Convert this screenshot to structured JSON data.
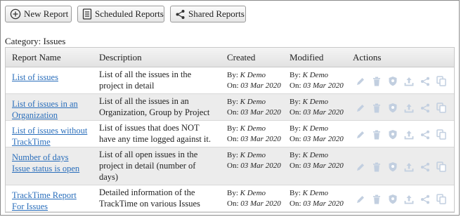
{
  "toolbar": {
    "new_report": "New Report",
    "scheduled_reports": "Scheduled Reports",
    "shared_reports": "Shared Reports"
  },
  "category_label": "Category: Issues",
  "table": {
    "headers": {
      "name": "Report Name",
      "description": "Description",
      "created": "Created",
      "modified": "Modified",
      "actions": "Actions"
    },
    "meta_labels": {
      "by": "By:",
      "on": "On:"
    },
    "rows": [
      {
        "name_lines": [
          "List of issues"
        ],
        "desc_lines": [
          "List of all the issues in the",
          "project in detail"
        ],
        "created_by": "K Demo",
        "created_on": "03 Mar 2020",
        "modified_by": "K Demo",
        "modified_on": "03 Mar 2020"
      },
      {
        "name_lines": [
          "List of issues in an",
          "Organization"
        ],
        "desc_lines": [
          "List of all the issues in an",
          "Organization, Group by Project"
        ],
        "created_by": "K Demo",
        "created_on": "03 Mar 2020",
        "modified_by": "K Demo",
        "modified_on": "03 Mar 2020"
      },
      {
        "name_lines": [
          "List of issues without",
          "TrackTime"
        ],
        "desc_lines": [
          "List of issues that does NOT",
          "have any time logged against it."
        ],
        "created_by": "K Demo",
        "created_on": "03 Mar 2020",
        "modified_by": "K Demo",
        "modified_on": "03 Mar 2020"
      },
      {
        "name_lines": [
          "Number of days",
          "Issue status is open"
        ],
        "desc_lines": [
          "List of all open issues in the",
          "project in detail (number of",
          "days)"
        ],
        "created_by": "K Demo",
        "created_on": "03 Mar 2020",
        "modified_by": "K Demo",
        "modified_on": "03 Mar 2020"
      },
      {
        "name_lines": [
          "TrackTime Report",
          "For Issues"
        ],
        "desc_lines": [
          "Detailed information of the",
          "TrackTime on various Issues"
        ],
        "created_by": "K Demo",
        "created_on": "03 Mar 2020",
        "modified_by": "K Demo",
        "modified_on": "03 Mar 2020"
      }
    ],
    "action_icons": [
      "edit-icon",
      "delete-icon",
      "permissions-shield-icon",
      "export-icon",
      "share-icon",
      "copy-icon"
    ]
  },
  "colors": {
    "link": "#2a6ebb",
    "action_icon": "#c2cfe0",
    "row_alt": "#ececec"
  }
}
